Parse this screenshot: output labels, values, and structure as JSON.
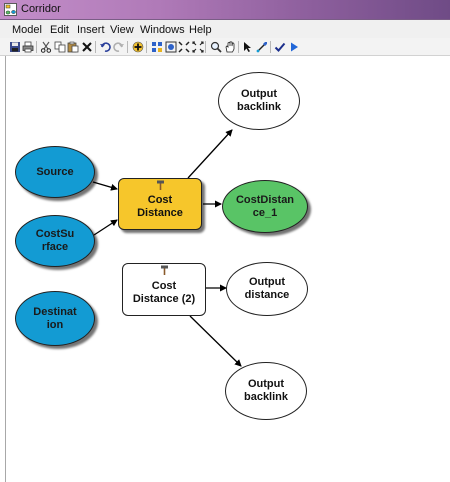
{
  "window": {
    "title": "Corridor"
  },
  "menu": {
    "items": [
      "Model",
      "Edit",
      "Insert",
      "View",
      "Windows",
      "Help"
    ]
  },
  "toolbar": {
    "buttons": [
      "save-icon",
      "print-icon",
      "cut-icon",
      "copy-icon",
      "paste-icon",
      "delete-icon",
      "undo-icon",
      "redo-icon",
      "add-data-icon",
      "auto-layout-icon",
      "full-extent-icon",
      "zoom-in-fixed-icon",
      "zoom-out-fixed-icon",
      "zoom-icon",
      "pan-icon",
      "select-icon",
      "connect-icon",
      "validate-icon",
      "run-icon"
    ]
  },
  "model": {
    "source": "Source",
    "cost_surface": "CostSurface",
    "cost_distance_1": "Cost Distance",
    "cost_distance_output": "CostDistance_1",
    "output_backlink_1": "Output backlink",
    "destination": "Destination",
    "cost_distance_2": "Cost Distance (2)",
    "output_distance": "Output distance",
    "output_backlink_2": "Output backlink"
  },
  "colors": {
    "input_data": "#139bd3",
    "tool": "#f6c62b",
    "derived_data": "#59c466",
    "not_ready": "#ffffff"
  }
}
